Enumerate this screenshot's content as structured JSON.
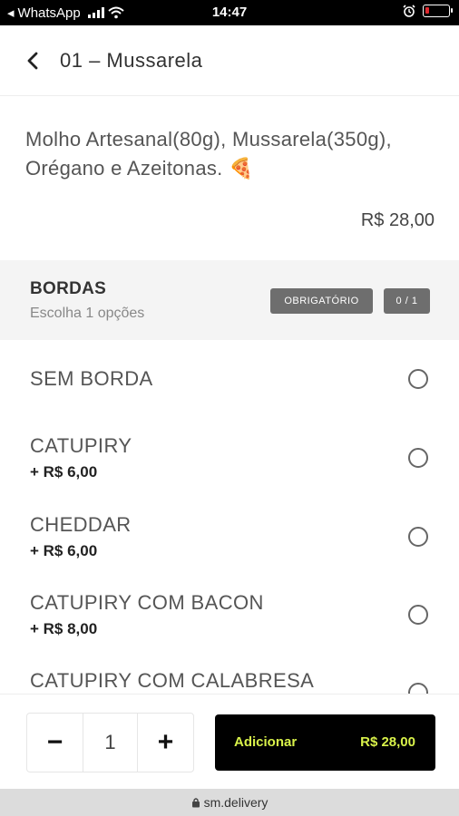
{
  "statusbar": {
    "carrier_app": "WhatsApp",
    "time": "14:47",
    "battery_level": 0.15
  },
  "header": {
    "title": "01 – Mussarela"
  },
  "product": {
    "description": "Molho Artesanal(80g), Mussarela(350g), Orégano e Azeitonas. 🍕",
    "price": "R$ 28,00"
  },
  "section": {
    "title": "BORDAS",
    "subtitle": "Escolha 1 opções",
    "required_badge": "OBRIGATÓRIO",
    "count_badge": "0 / 1"
  },
  "options": [
    {
      "name": "SEM BORDA",
      "extra": ""
    },
    {
      "name": "CATUPIRY",
      "extra": "+ R$ 6,00"
    },
    {
      "name": "CHEDDAR",
      "extra": "+ R$ 6,00"
    },
    {
      "name": "CATUPIRY COM BACON",
      "extra": "+ R$ 8,00"
    },
    {
      "name": "CATUPIRY COM CALABRESA",
      "extra": ""
    }
  ],
  "footer": {
    "minus": "−",
    "quantity": "1",
    "plus": "+",
    "add_label": "Adicionar",
    "add_amount": "R$ 28,00"
  },
  "browser": {
    "url": "sm.delivery"
  }
}
